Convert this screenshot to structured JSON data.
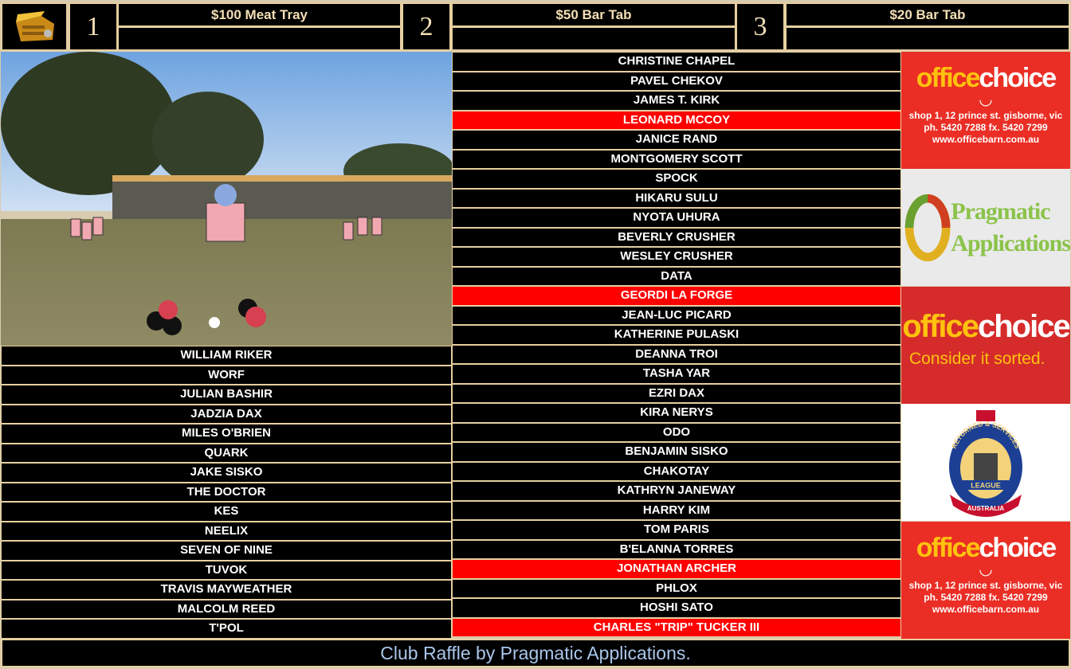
{
  "header": {
    "logo_icon": "treasure-chest-icon",
    "prizes": [
      {
        "number": "1",
        "label": "$100 Meat Tray",
        "winner": ""
      },
      {
        "number": "2",
        "label": "$50 Bar Tab",
        "winner": ""
      },
      {
        "number": "3",
        "label": "$20 Bar Tab",
        "winner": ""
      }
    ]
  },
  "left_names": [
    {
      "name": "WILLIAM RIKER",
      "win": false
    },
    {
      "name": "WORF",
      "win": false
    },
    {
      "name": "JULIAN BASHIR",
      "win": false
    },
    {
      "name": "JADZIA DAX",
      "win": false
    },
    {
      "name": "MILES O'BRIEN",
      "win": false
    },
    {
      "name": "QUARK",
      "win": false
    },
    {
      "name": "JAKE SISKO",
      "win": false
    },
    {
      "name": "THE DOCTOR",
      "win": false
    },
    {
      "name": "KES",
      "win": false
    },
    {
      "name": "NEELIX",
      "win": false
    },
    {
      "name": "SEVEN OF NINE",
      "win": false
    },
    {
      "name": "TUVOK",
      "win": false
    },
    {
      "name": "TRAVIS MAYWEATHER",
      "win": false
    },
    {
      "name": "MALCOLM REED",
      "win": false
    },
    {
      "name": "T'POL",
      "win": false
    }
  ],
  "middle_names": [
    {
      "name": "CHRISTINE CHAPEL",
      "win": false
    },
    {
      "name": "PAVEL CHEKOV",
      "win": false
    },
    {
      "name": "JAMES T. KIRK",
      "win": false
    },
    {
      "name": "LEONARD MCCOY",
      "win": true
    },
    {
      "name": "JANICE RAND",
      "win": false
    },
    {
      "name": "MONTGOMERY SCOTT",
      "win": false
    },
    {
      "name": "SPOCK",
      "win": false
    },
    {
      "name": "HIKARU SULU",
      "win": false
    },
    {
      "name": "NYOTA UHURA",
      "win": false
    },
    {
      "name": "BEVERLY CRUSHER",
      "win": false
    },
    {
      "name": "WESLEY CRUSHER",
      "win": false
    },
    {
      "name": "DATA",
      "win": false
    },
    {
      "name": "GEORDI LA FORGE",
      "win": true
    },
    {
      "name": "JEAN-LUC PICARD",
      "win": false
    },
    {
      "name": "KATHERINE PULASKI",
      "win": false
    },
    {
      "name": "DEANNA TROI",
      "win": false
    },
    {
      "name": "TASHA YAR",
      "win": false
    },
    {
      "name": "EZRI DAX",
      "win": false
    },
    {
      "name": "KIRA NERYS",
      "win": false
    },
    {
      "name": "ODO",
      "win": false
    },
    {
      "name": "BENJAMIN SISKO",
      "win": false
    },
    {
      "name": "CHAKOTAY",
      "win": false
    },
    {
      "name": "KATHRYN JANEWAY",
      "win": false
    },
    {
      "name": "HARRY KIM",
      "win": false
    },
    {
      "name": "TOM PARIS",
      "win": false
    },
    {
      "name": "B'ELANNA TORRES",
      "win": false
    },
    {
      "name": "JONATHAN ARCHER",
      "win": true
    },
    {
      "name": "PHLOX",
      "win": false
    },
    {
      "name": "HOSHI SATO",
      "win": false
    },
    {
      "name": "CHARLES \"TRIP\" TUCKER III",
      "win": true
    }
  ],
  "ads": {
    "office1": {
      "logo_a": "office",
      "logo_b": "choice",
      "line1": "shop 1, 12 prince st. gisborne, vic",
      "line2": "ph. 5420 7288  fx. 5420 7299",
      "line3": "www.officebarn.com.au"
    },
    "pragmatic": {
      "line1": "Pragmatic",
      "line2": "Applications"
    },
    "office2": {
      "logo_a": "office",
      "logo_b": "choice",
      "tagline": "Consider it sorted."
    },
    "rsl": {
      "ring_text": "RETURNED & SERVICES",
      "banner": "LEAGUE",
      "country": "AUSTRALIA"
    },
    "office3": {
      "logo_a": "office",
      "logo_b": "choice",
      "line1": "shop 1, 12 prince st. gisborne, vic",
      "line2": "ph. 5420 7288  fx. 5420 7299",
      "line3": "www.officebarn.com.au"
    }
  },
  "footer": {
    "text": "Club Raffle by Pragmatic Applications."
  },
  "colors": {
    "win": "#ff0000",
    "border": "#e6cfa0",
    "footer_text": "#a9c6ea"
  }
}
